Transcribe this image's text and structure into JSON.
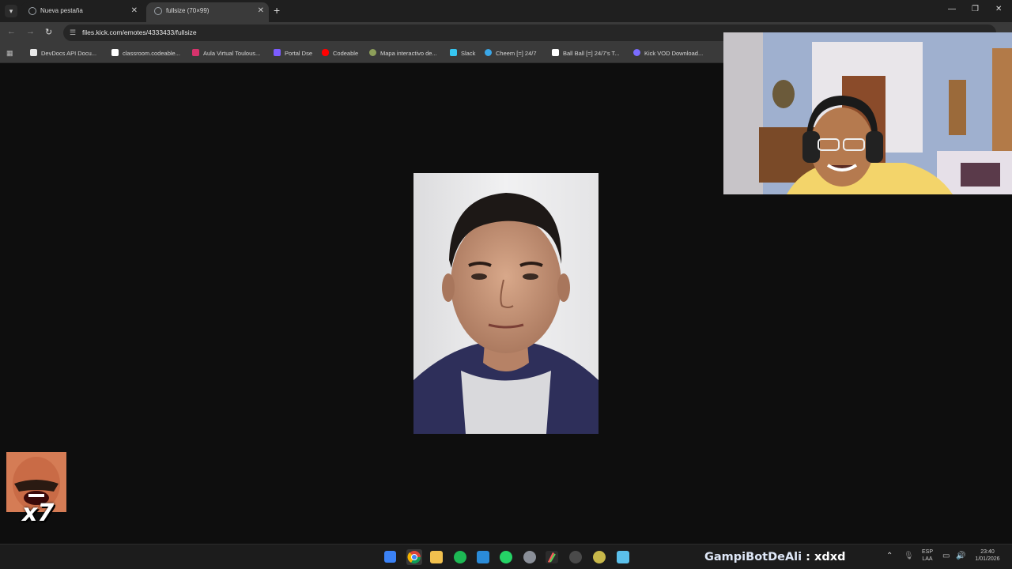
{
  "browser": {
    "tabs": [
      {
        "title": "Nueva pestaña",
        "active": false
      },
      {
        "title": "fullsize (70×99)",
        "active": true
      }
    ],
    "url": "files.kick.com/emotes/4333433/fullsize",
    "bookmarks": [
      {
        "label": "DevDocs API Docu...",
        "icon_color": "#e8e8e8"
      },
      {
        "label": "classroom.codeable...",
        "icon_color": "#ffffff"
      },
      {
        "label": "Aula Virtual Toulous...",
        "icon_color": "#d6336c"
      },
      {
        "label": "Portal Dse",
        "icon_color": "#7b5cff"
      },
      {
        "label": "Codeable",
        "icon_color": "#ff0000"
      },
      {
        "label": "Mapa interactivo de...",
        "icon_color": "#8d9f5a"
      },
      {
        "label": "Slack",
        "icon_color": "#36c5f0"
      },
      {
        "label": "Cheem [=] 24/7",
        "icon_color": "#3aa7e8"
      },
      {
        "label": "Ball Ball [=] 24/7's T...",
        "icon_color": "#ffffff"
      },
      {
        "label": "Kick VOD Download...",
        "icon_color": "#7a6cff"
      }
    ]
  },
  "stream_overlay": {
    "emote_count": "x7",
    "chat_user": "GampiBotDeAli",
    "chat_separator": " : ",
    "chat_message": "xdxd"
  },
  "taskbar": {
    "language": "ESP",
    "keyboard": "LAA",
    "time": "23:40",
    "date": "1/01/2026"
  },
  "colors": {
    "accent_blue": "#3b82f6",
    "page_background": "#0e0e0e"
  }
}
